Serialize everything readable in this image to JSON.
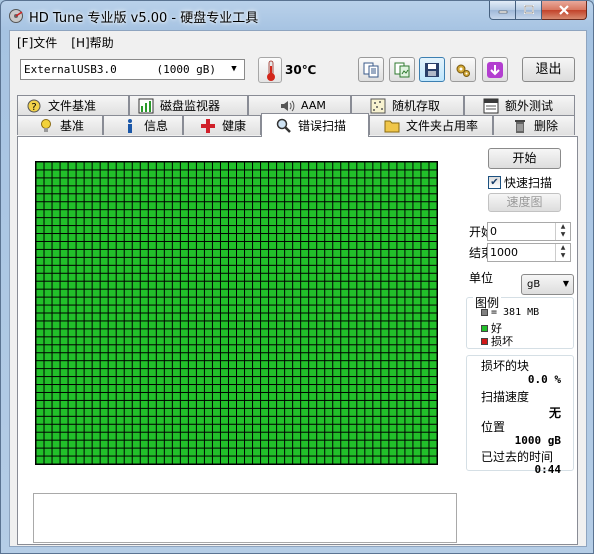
{
  "window": {
    "title": "HD Tune 专业版 v5.00 - 硬盘专业工具"
  },
  "menu": [
    {
      "label": "[F]文件"
    },
    {
      "label": "[H]帮助"
    }
  ],
  "toolbar": {
    "drive": "ExternalUSB3.0      (1000 gB)",
    "temperature": "30℃",
    "exit_label": "退出"
  },
  "tabs": {
    "row_top": [
      {
        "label": "文件基准",
        "icon": "file-benchmark-icon"
      },
      {
        "label": "磁盘监视器",
        "icon": "disk-monitor-icon"
      },
      {
        "label": "AAM",
        "icon": "speaker-icon"
      },
      {
        "label": "随机存取",
        "icon": "random-access-icon"
      },
      {
        "label": "额外测试",
        "icon": "extra-tests-icon"
      }
    ],
    "row_bottom": [
      {
        "label": "基准",
        "icon": "lightbulb-icon"
      },
      {
        "label": "信息",
        "icon": "info-icon"
      },
      {
        "label": "健康",
        "icon": "health-cross-icon"
      },
      {
        "label": "错误扫描",
        "icon": "magnifier-icon"
      },
      {
        "label": "文件夹占用率",
        "icon": "folder-icon"
      },
      {
        "label": "删除",
        "icon": "trash-icon"
      }
    ],
    "selected": "错误扫描"
  },
  "scan": {
    "start_button": "开始",
    "quick_scan_label": "快速扫描",
    "quick_scan_checked": true,
    "speed_map_button": "速度图",
    "start_label": "开始",
    "start_value": "0",
    "end_label": "结束",
    "end_value": "1000",
    "unit_label": "单位",
    "unit_value": "gB",
    "grid_color_good": "#22c02a",
    "grid_cols": 50,
    "grid_rows": 38
  },
  "legend": {
    "title": "图例",
    "block_size": "= 381 MB",
    "good": "好",
    "damaged": "损坏",
    "color_block": "#808080",
    "color_good": "#22c02a",
    "color_damaged": "#d01818"
  },
  "stats": {
    "damaged_blocks_label": "损坏的块",
    "damaged_blocks_value": "0.0 %",
    "scan_speed_label": "扫描速度",
    "scan_speed_value": "无",
    "position_label": "位置",
    "position_value": "1000 gB",
    "elapsed_label": "已过去的时间",
    "elapsed_value": "0:44"
  }
}
